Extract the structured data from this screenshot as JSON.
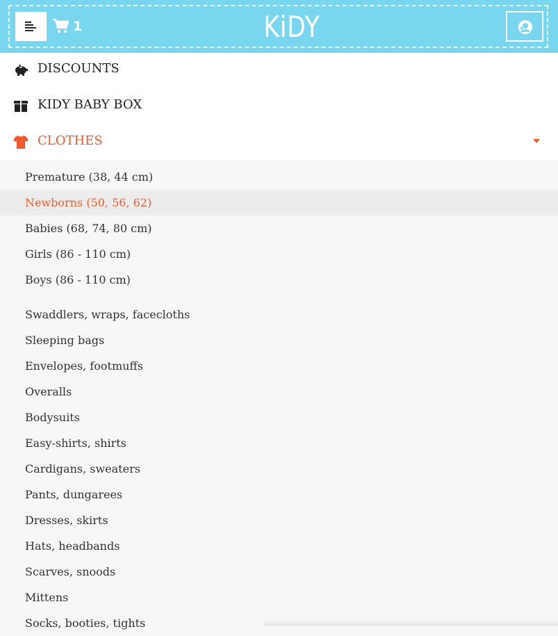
{
  "header": {
    "logo_text": "KiDY",
    "cart_count": "1",
    "icons": [
      "menu-icon",
      "cart-icon",
      "account-icon"
    ],
    "background_color": "#78d7ee"
  },
  "nav": {
    "items": [
      {
        "label": "DISCOUNTS",
        "icon": "piggy-bank-icon",
        "active": false
      },
      {
        "label": "KIDY BABY BOX",
        "icon": "gift-box-icon",
        "active": false
      },
      {
        "label": "CLOTHES",
        "icon": "tshirt-icon",
        "active": true
      }
    ],
    "accent_color": "#ef5a2e"
  },
  "submenu": {
    "items": [
      {
        "label": "Premature (38, 44 cm)"
      },
      {
        "label": "Newborns (50, 56, 62)",
        "highlighted": true
      },
      {
        "label": "Babies (68, 74, 80 cm)"
      },
      {
        "label": "Girls (86 - 110 cm)"
      },
      {
        "label": "Boys (86 - 110 cm)"
      },
      {
        "label": "Swaddlers, wraps, facecloths"
      },
      {
        "label": "Sleeping bags"
      },
      {
        "label": "Envelopes, footmuffs"
      },
      {
        "label": "Overalls"
      },
      {
        "label": "Bodysuits"
      },
      {
        "label": "Easy-shirts, shirts"
      },
      {
        "label": "Cardigans, sweaters"
      },
      {
        "label": "Pants, dungarees"
      },
      {
        "label": "Dresses, skirts"
      },
      {
        "label": "Hats, headbands"
      },
      {
        "label": "Scarves, snoods"
      },
      {
        "label": "Mittens"
      },
      {
        "label": "Socks, booties, tights"
      }
    ]
  }
}
